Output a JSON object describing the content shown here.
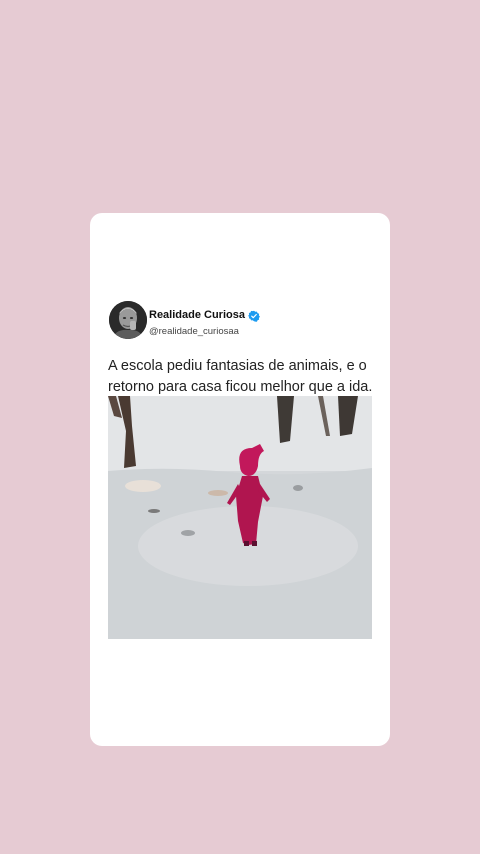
{
  "tweet": {
    "display_name": "Realidade Curiosa",
    "handle": "@realidade_curiosaa",
    "verified": true,
    "text": "A escola pediu fantasias de animais, e o retorno para casa ficou melhor que a ida."
  },
  "colors": {
    "background": "#e6cbd3",
    "card": "#ffffff",
    "verified_badge": "#1d9bf0",
    "costume": "#c2185b"
  },
  "icons": {
    "verified": "verified-badge-icon"
  }
}
